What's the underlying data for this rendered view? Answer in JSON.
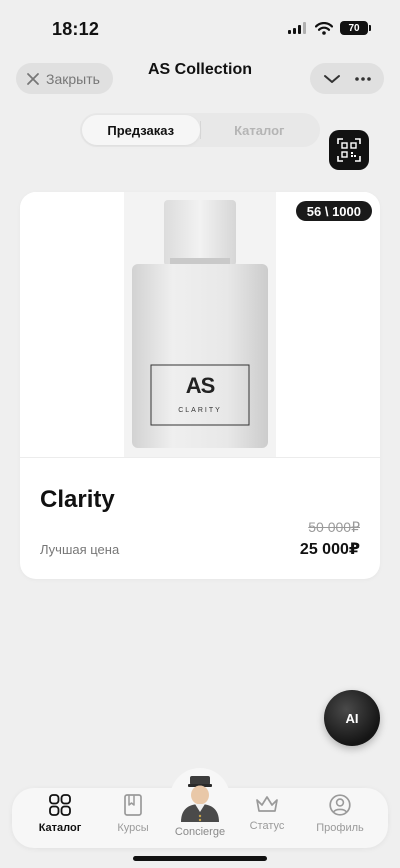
{
  "status_bar": {
    "time": "18:12",
    "battery": "70"
  },
  "header": {
    "close_label": "Закрыть",
    "title": "AS Collection"
  },
  "segmented": {
    "tabs": [
      {
        "label": "Предзаказ",
        "active": true
      },
      {
        "label": "Каталог",
        "active": false
      }
    ]
  },
  "product": {
    "counter": "56 \\ 1000",
    "name": "Clarity",
    "price_caption": "Лучшая цена",
    "old_price": "50 000₽",
    "new_price": "25 000₽",
    "label_logo": "AS",
    "label_text": "CLARITY"
  },
  "ai_button": {
    "label": "AI"
  },
  "tab_bar": {
    "items": [
      {
        "label": "Каталог",
        "icon": "grid-icon",
        "active": true
      },
      {
        "label": "Курсы",
        "icon": "book-icon",
        "active": false
      },
      {
        "label": "Concierge",
        "icon": "concierge-avatar",
        "active": false
      },
      {
        "label": "Статус",
        "icon": "crown-icon",
        "active": false
      },
      {
        "label": "Профиль",
        "icon": "user-circle-icon",
        "active": false
      }
    ]
  },
  "colors": {
    "background": "#efefef",
    "card": "#ffffff",
    "accent_dark": "#111111",
    "muted_text": "#9a9a9a"
  }
}
